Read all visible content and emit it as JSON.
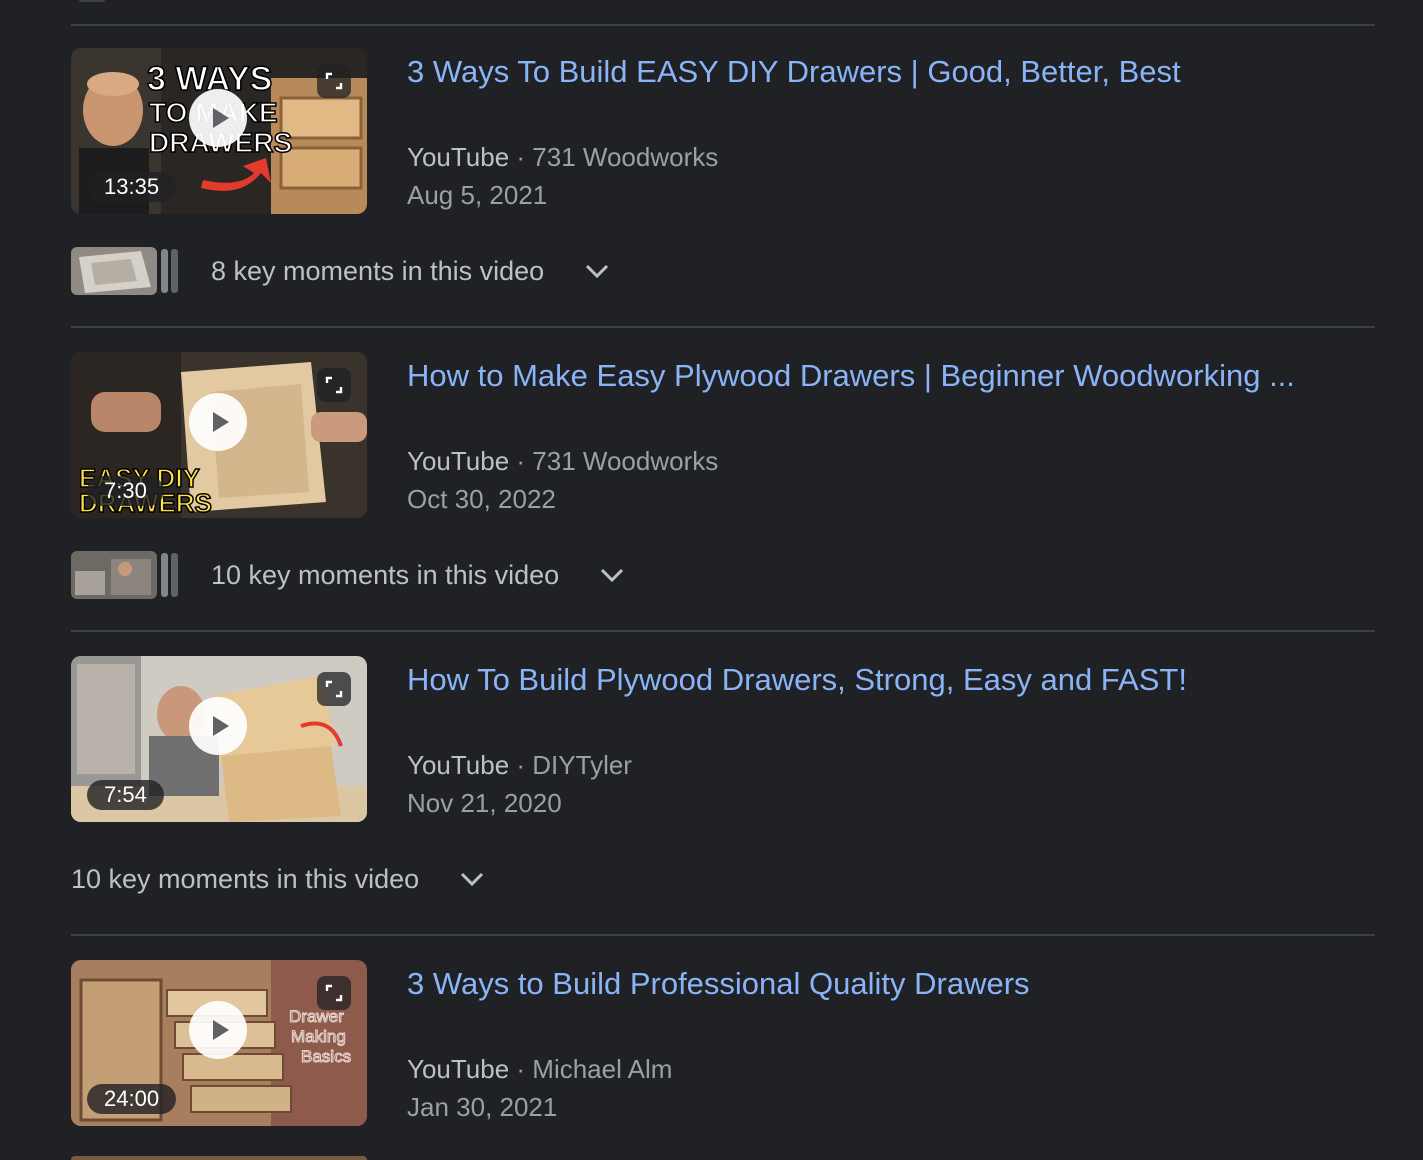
{
  "results": [
    {
      "title": "3 Ways To Build EASY DIY Drawers | Good, Better, Best",
      "source": "YouTube",
      "separator": " · ",
      "channel": "731 Woodworks",
      "date": "Aug 5, 2021",
      "duration": "13:35",
      "thumb_text": [
        "3 WAYS",
        "TO MAKE",
        "DRAWERS"
      ],
      "key_moments": "8 key moments in this video",
      "has_moment_thumb": true
    },
    {
      "title": "How to Make Easy Plywood Drawers | Beginner Woodworking ...",
      "source": "YouTube",
      "separator": " · ",
      "channel": "731 Woodworks",
      "date": "Oct 30, 2022",
      "duration": "7:30",
      "thumb_text": [
        "EASY DIY",
        "DRAWERS"
      ],
      "key_moments": "10 key moments in this video",
      "has_moment_thumb": true
    },
    {
      "title": "How To Build Plywood Drawers, Strong, Easy and FAST!",
      "source": "YouTube",
      "separator": " · ",
      "channel": "DIYTyler",
      "date": "Nov 21, 2020",
      "duration": "7:54",
      "key_moments": "10 key moments in this video",
      "has_moment_thumb": false
    },
    {
      "title": "3 Ways to Build Professional Quality Drawers",
      "source": "YouTube",
      "separator": " · ",
      "channel": "Michael Alm",
      "date": "Jan 30, 2021",
      "duration": "24:00",
      "thumb_text": [
        "Drawer",
        "Making",
        "Basics"
      ]
    }
  ],
  "icons": {
    "play": "play-icon",
    "expand": "expand-icon",
    "chevron": "chevron-down-icon"
  },
  "colors": {
    "background": "#202124",
    "title": "#8ab4f8",
    "source": "#bdc1c6",
    "meta": "#9aa0a6",
    "divider": "#3c4043"
  }
}
